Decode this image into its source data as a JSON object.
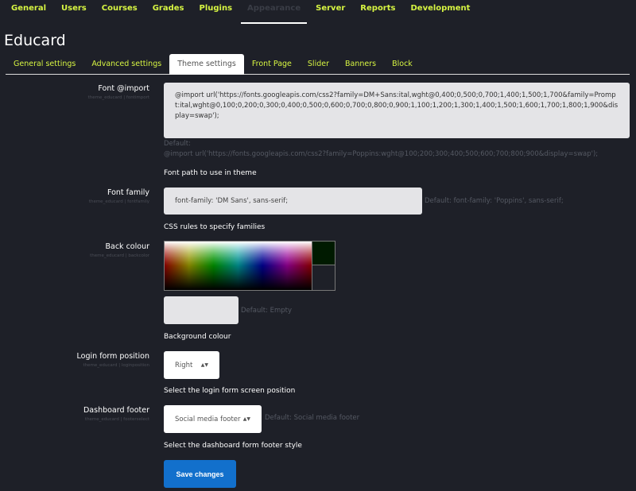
{
  "topnav": [
    "General",
    "Users",
    "Courses",
    "Grades",
    "Plugins",
    "Appearance",
    "Server",
    "Reports",
    "Development"
  ],
  "title": "Educard",
  "tabs": [
    "General settings",
    "Advanced settings",
    "Theme settings",
    "Front Page",
    "Slider",
    "Banners",
    "Block"
  ],
  "fontimport": {
    "label": "Font @import",
    "key": "theme_educard | fontimport",
    "value": "@import url('https://fonts.googleapis.com/css2?family=DM+Sans:ital,wght@0,400;0,500;0,700;1,400;1,500;1,700&family=Prompt:ital,wght@0,100;0,200;0,300;0,400;0,500;0,600;0,700;0,800;0,900;1,100;1,200;1,300;1,400;1,500;1,600;1,700;1,800;1,900&display=swap');",
    "default_label": "Default:",
    "default": "@import url('https://fonts.googleapis.com/css2?family=Poppins:wght@100;200;300;400;500;600;700;800;900&display=swap');",
    "desc": "Font path to use in theme"
  },
  "fontfamily": {
    "label": "Font family",
    "key": "theme_educard | fontfamily",
    "value": "font-family: 'DM Sans', sans-serif;",
    "default": "Default: font-family: 'Poppins', sans-serif;",
    "desc": "CSS rules to specify families"
  },
  "backcolor": {
    "label": "Back colour",
    "key": "theme_educard | backcolor",
    "value": "",
    "default": "Default: Empty",
    "desc": "Background colour",
    "swatch": "#001a00"
  },
  "loginposition": {
    "label": "Login form position",
    "key": "theme_educard | loginposition",
    "value": "Right",
    "desc": "Select the login form screen position"
  },
  "footerselect": {
    "label": "Dashboard footer",
    "key": "theme_educard | footerselect",
    "value": "Social media footer",
    "default": "Default: Social media footer",
    "desc": "Select the dashboard form footer style"
  },
  "save": "Save changes",
  "colors": {
    "accent": "#d7f542",
    "background": "#1e2028",
    "primary": "#1270cc"
  }
}
